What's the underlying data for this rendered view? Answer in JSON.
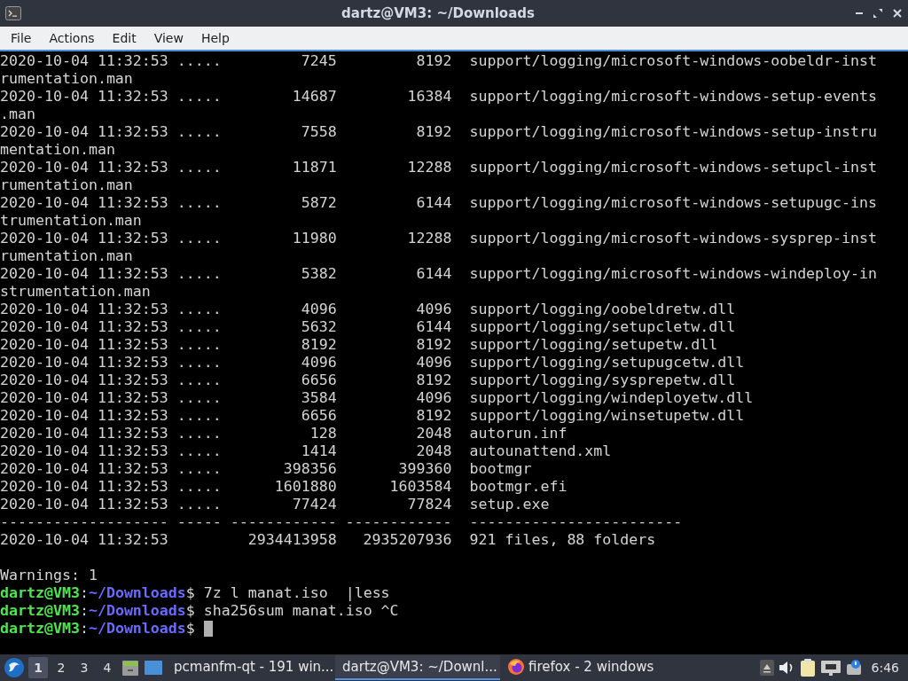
{
  "window": {
    "title": "dartz@VM3: ~/Downloads"
  },
  "menu": [
    "File",
    "Actions",
    "Edit",
    "View",
    "Help"
  ],
  "terminal": {
    "lines": [
      {
        "kind": "output",
        "text": "2020-10-04 11:32:53 .....         7245         8192  support/logging/microsoft-windows-oobeldr-inst"
      },
      {
        "kind": "output",
        "text": "rumentation.man"
      },
      {
        "kind": "output",
        "text": "2020-10-04 11:32:53 .....        14687        16384  support/logging/microsoft-windows-setup-events"
      },
      {
        "kind": "output",
        "text": ".man"
      },
      {
        "kind": "output",
        "text": "2020-10-04 11:32:53 .....         7558         8192  support/logging/microsoft-windows-setup-instru"
      },
      {
        "kind": "output",
        "text": "mentation.man"
      },
      {
        "kind": "output",
        "text": "2020-10-04 11:32:53 .....        11871        12288  support/logging/microsoft-windows-setupcl-inst"
      },
      {
        "kind": "output",
        "text": "rumentation.man"
      },
      {
        "kind": "output",
        "text": "2020-10-04 11:32:53 .....         5872         6144  support/logging/microsoft-windows-setupugc-ins"
      },
      {
        "kind": "output",
        "text": "trumentation.man"
      },
      {
        "kind": "output",
        "text": "2020-10-04 11:32:53 .....        11980        12288  support/logging/microsoft-windows-sysprep-inst"
      },
      {
        "kind": "output",
        "text": "rumentation.man"
      },
      {
        "kind": "output",
        "text": "2020-10-04 11:32:53 .....         5382         6144  support/logging/microsoft-windows-windeploy-in"
      },
      {
        "kind": "output",
        "text": "strumentation.man"
      },
      {
        "kind": "output",
        "text": "2020-10-04 11:32:53 .....         4096         4096  support/logging/oobeldretw.dll"
      },
      {
        "kind": "output",
        "text": "2020-10-04 11:32:53 .....         5632         6144  support/logging/setupcletw.dll"
      },
      {
        "kind": "output",
        "text": "2020-10-04 11:32:53 .....         8192         8192  support/logging/setupetw.dll"
      },
      {
        "kind": "output",
        "text": "2020-10-04 11:32:53 .....         4096         4096  support/logging/setupugcetw.dll"
      },
      {
        "kind": "output",
        "text": "2020-10-04 11:32:53 .....         6656         8192  support/logging/sysprepetw.dll"
      },
      {
        "kind": "output",
        "text": "2020-10-04 11:32:53 .....         3584         4096  support/logging/windeployetw.dll"
      },
      {
        "kind": "output",
        "text": "2020-10-04 11:32:53 .....         6656         8192  support/logging/winsetupetw.dll"
      },
      {
        "kind": "output",
        "text": "2020-10-04 11:32:53 .....          128         2048  autorun.inf"
      },
      {
        "kind": "output",
        "text": "2020-10-04 11:32:53 .....         1414         2048  autounattend.xml"
      },
      {
        "kind": "output",
        "text": "2020-10-04 11:32:53 .....       398356       399360  bootmgr"
      },
      {
        "kind": "output",
        "text": "2020-10-04 11:32:53 .....      1601880      1603584  bootmgr.efi"
      },
      {
        "kind": "output",
        "text": "2020-10-04 11:32:53 .....        77424        77824  setup.exe"
      },
      {
        "kind": "output",
        "text": "------------------- ----- ------------ ------------  ------------------------"
      },
      {
        "kind": "output",
        "text": "2020-10-04 11:32:53         2934413958   2935207936  921 files, 88 folders"
      },
      {
        "kind": "blank"
      },
      {
        "kind": "output",
        "text": "Warnings: 1"
      },
      {
        "kind": "prompt",
        "user": "dartz@VM3",
        "separator": ":",
        "path": "~/Downloads",
        "symbol": "$",
        "command": "7z l manat.iso  |less",
        "cursor": false
      },
      {
        "kind": "prompt",
        "user": "dartz@VM3",
        "separator": ":",
        "path": "~/Downloads",
        "symbol": "$",
        "command": "sha256sum manat.iso ^C",
        "cursor": false
      },
      {
        "kind": "prompt",
        "user": "dartz@VM3",
        "separator": ":",
        "path": "~/Downloads",
        "symbol": "$",
        "cursor": true
      }
    ]
  },
  "taskbar": {
    "workspaces": [
      {
        "label": "1",
        "selected": true
      },
      {
        "label": "2",
        "selected": false
      },
      {
        "label": "3",
        "selected": false
      },
      {
        "label": "4",
        "selected": false
      }
    ],
    "tasks": [
      {
        "kind": "folder",
        "label": "pcmanfm-qt - 191 win...",
        "selected": false
      },
      {
        "kind": "terminal",
        "label": "dartz@VM3: ~/Downl...",
        "selected": true
      },
      {
        "kind": "browser",
        "label": "firefox - 2 windows",
        "selected": false
      }
    ],
    "clock": "6:46"
  }
}
